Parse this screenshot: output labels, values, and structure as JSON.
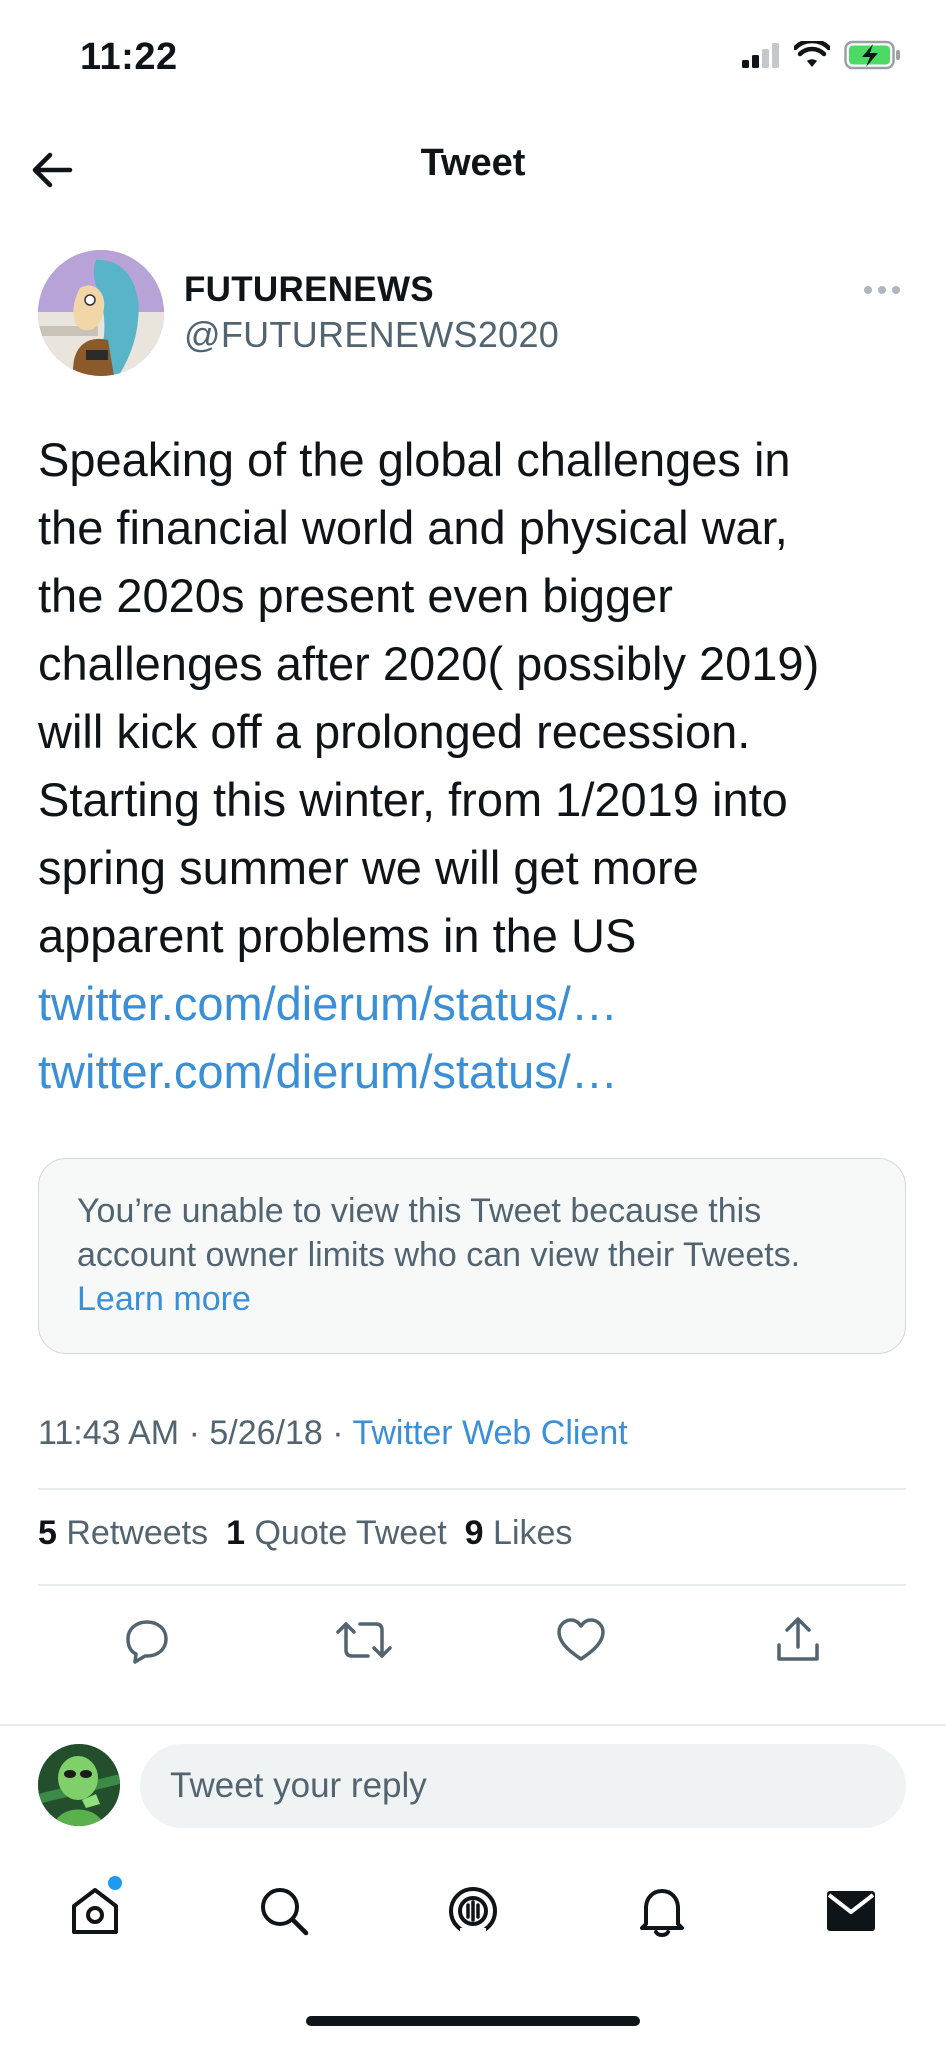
{
  "status_bar": {
    "time": "11:22",
    "icons": [
      "signal-icon",
      "wifi-icon",
      "battery-charging-icon"
    ]
  },
  "header": {
    "back_icon": "arrow-left-icon",
    "title": "Tweet"
  },
  "author": {
    "name": "FUTURENEWS",
    "handle": "@FUTURENEWS2020",
    "more_icon": "more-horizontal-icon"
  },
  "tweet": {
    "lines": [
      "Speaking of the global challenges in",
      "the financial world and physical war,",
      "the 2020s present even bigger",
      "challenges after 2020( possibly 2019)",
      "will kick off a prolonged recession.",
      "Starting this winter, from 1/2019 into",
      "spring summer we will get more",
      "apparent problems in the US"
    ],
    "links": [
      "twitter.com/dierum/status/…",
      "twitter.com/dierum/status/…"
    ]
  },
  "restricted_card": {
    "line1": "You’re unable to view this Tweet because this",
    "line2": "account owner limits who can view their Tweets.",
    "learn_more": "Learn more"
  },
  "meta": {
    "time": "11:43 AM",
    "date": "5/26/18",
    "separator": "·",
    "client": "Twitter Web Client"
  },
  "stats": {
    "retweets_count": "5",
    "retweets_label": "Retweets",
    "quotes_count": "1",
    "quotes_label": "Quote Tweet",
    "likes_count": "9",
    "likes_label": "Likes"
  },
  "actions": [
    "reply-icon",
    "retweet-icon",
    "like-icon",
    "share-icon"
  ],
  "reply": {
    "placeholder": "Tweet your reply"
  },
  "tabbar": {
    "tabs": [
      "home-icon",
      "search-icon",
      "spaces-icon",
      "notifications-icon",
      "messages-icon"
    ]
  },
  "colors": {
    "link": "#3a8fd6",
    "secondary_text": "#536471",
    "accent": "#1d9bf0"
  }
}
